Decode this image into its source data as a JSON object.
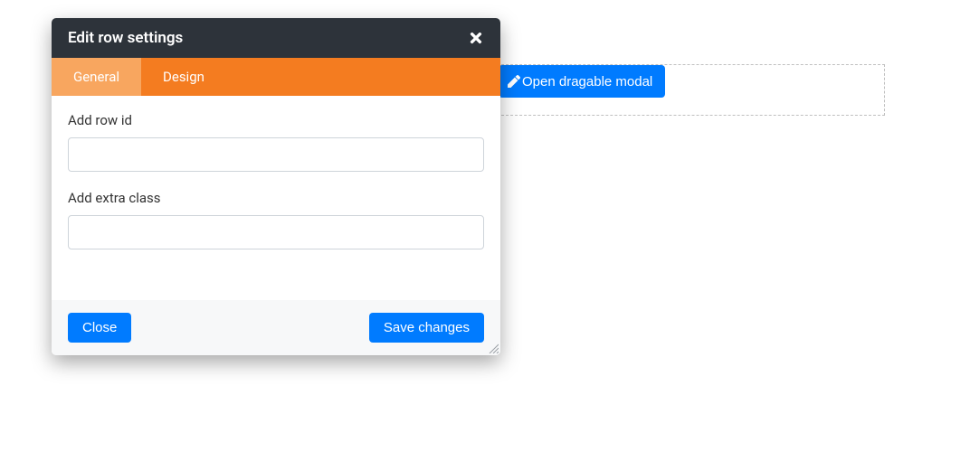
{
  "background_button": {
    "label": "Open dragable modal"
  },
  "modal": {
    "title": "Edit row settings",
    "tabs": [
      {
        "label": "General",
        "active": true
      },
      {
        "label": "Design",
        "active": false
      }
    ],
    "fields": {
      "row_id": {
        "label": "Add row id",
        "value": ""
      },
      "extra_class": {
        "label": "Add extra class",
        "value": ""
      }
    },
    "footer": {
      "close": "Close",
      "save": "Save changes"
    }
  }
}
